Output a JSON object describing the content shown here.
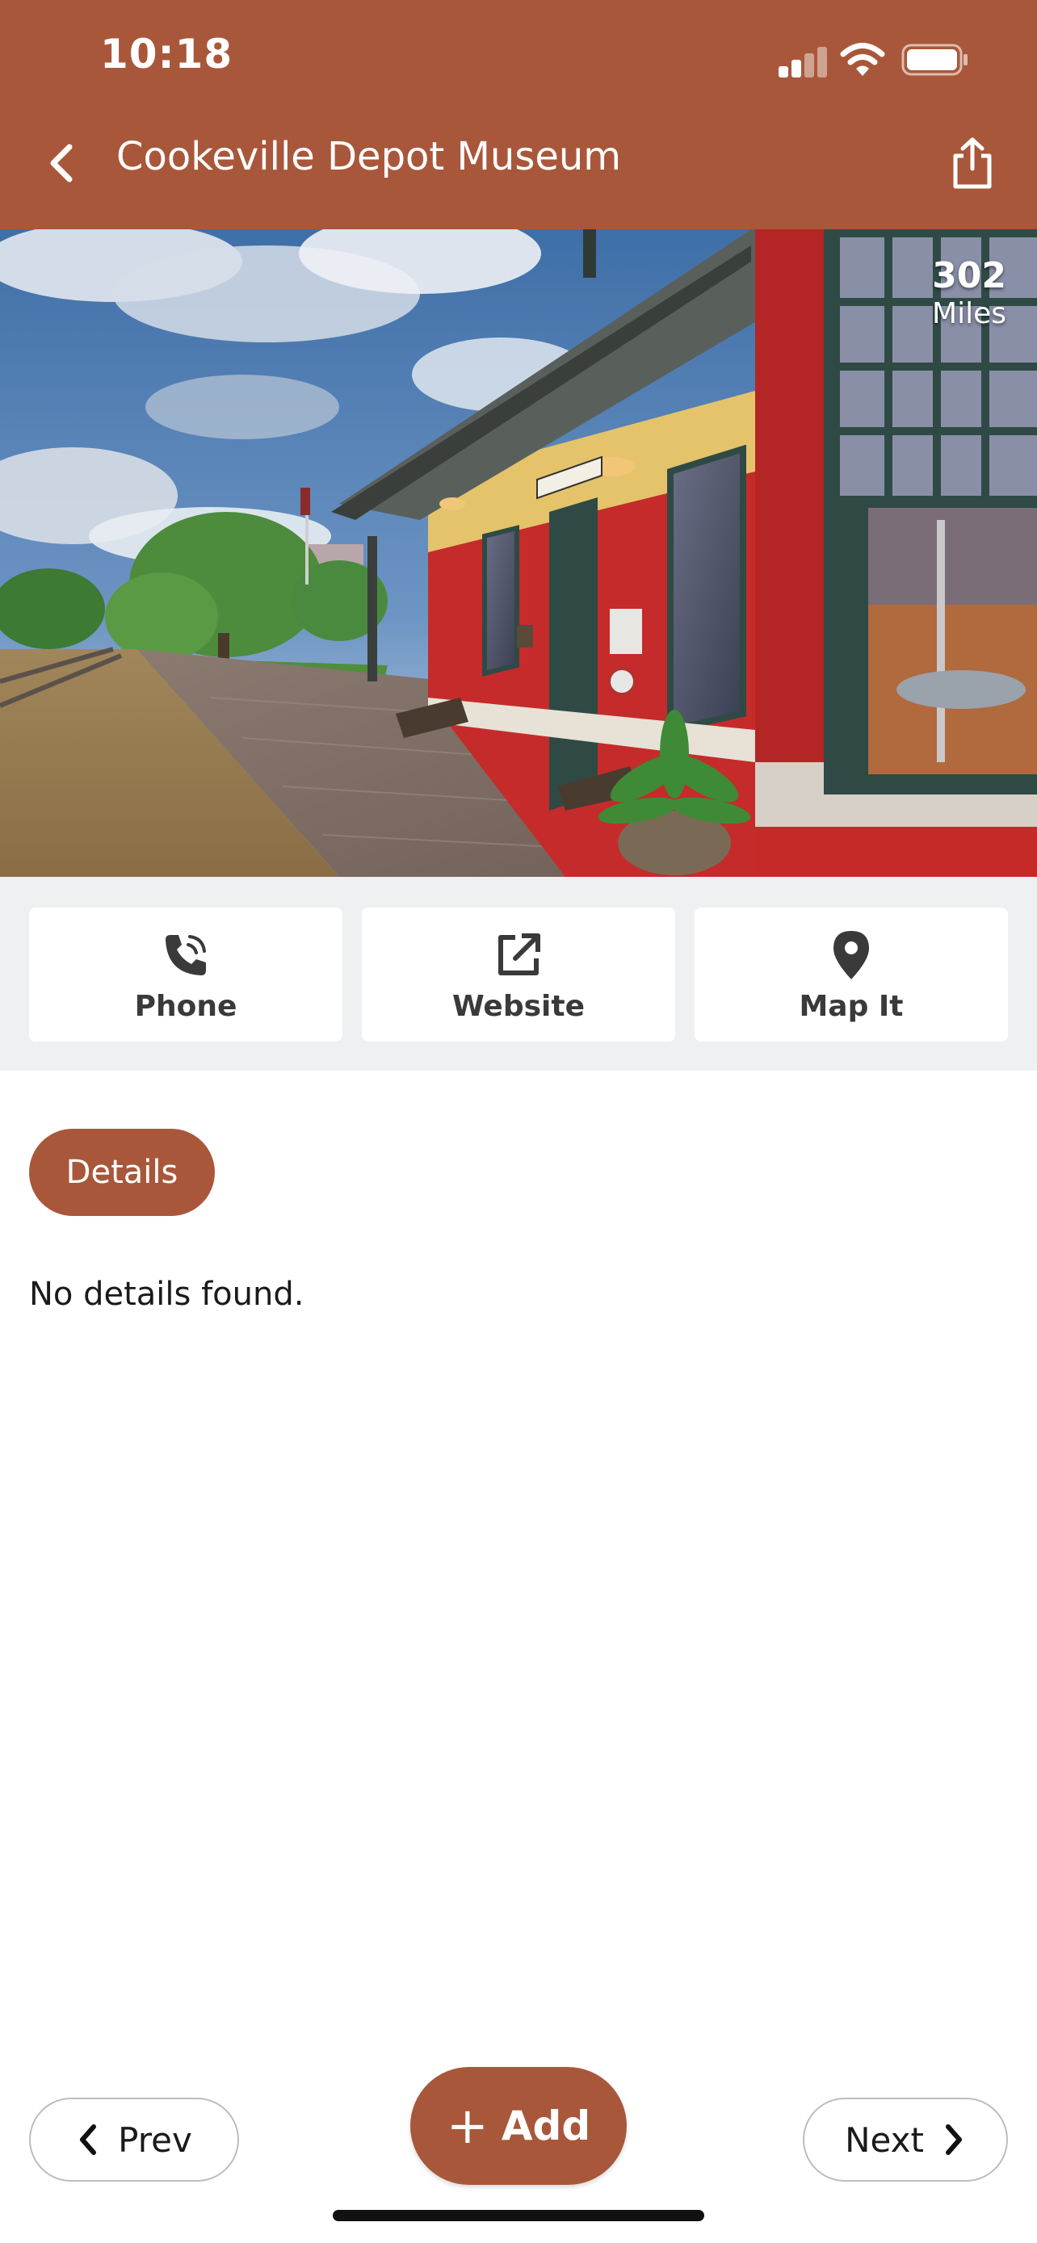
{
  "status_bar": {
    "time": "10:18",
    "icons": [
      "cellular-signal-icon",
      "wifi-icon",
      "battery-icon"
    ]
  },
  "header": {
    "title": "Cookeville Depot Museum",
    "back_icon": "chevron-left-icon",
    "share_icon": "share-icon",
    "background_color": "#a9573a"
  },
  "photo": {
    "distance_value": "302",
    "distance_unit": "Miles"
  },
  "actions": [
    {
      "label": "Phone",
      "icon": "phone-icon"
    },
    {
      "label": "Website",
      "icon": "external-link-icon"
    },
    {
      "label": "Map It",
      "icon": "map-pin-icon"
    }
  ],
  "details": {
    "tab_label": "Details",
    "empty_message": "No details found."
  },
  "bottom_nav": {
    "prev_label": "Prev",
    "add_label": "Add",
    "next_label": "Next"
  },
  "colors": {
    "accent": "#a9573a",
    "action_bar_bg": "#eff0f1"
  }
}
